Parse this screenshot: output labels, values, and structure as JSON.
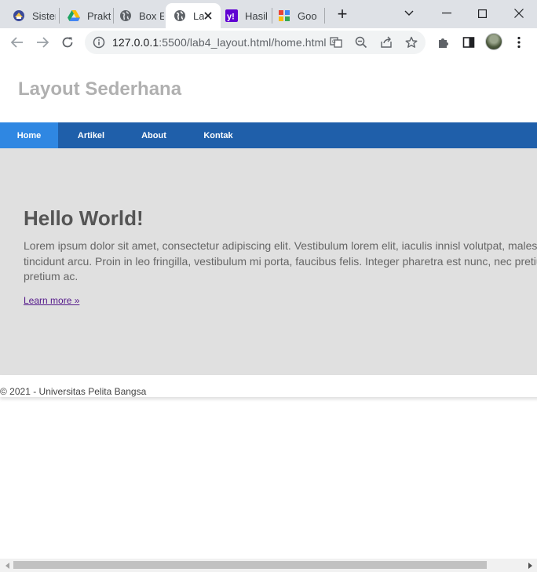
{
  "browser": {
    "tabs": [
      {
        "title": "Sister",
        "icon": "university-favicon-icon",
        "active": false
      },
      {
        "title": "Prakt",
        "icon": "google-drive-icon",
        "active": false
      },
      {
        "title": "Box E",
        "icon": "globe-icon",
        "active": false
      },
      {
        "title": "La",
        "icon": "globe-icon",
        "active": true
      },
      {
        "title": "Hasil",
        "icon": "yahoo-icon",
        "active": false
      },
      {
        "title": "Goo",
        "icon": "google-favicon-icon",
        "active": false
      }
    ],
    "new_tab_label": "+",
    "address": {
      "host": "127.0.0.1",
      "rest": ":5500/lab4_layout.html/home.html"
    }
  },
  "page": {
    "site_title": "Layout Sederhana",
    "nav": [
      {
        "label": "Home",
        "active": true
      },
      {
        "label": "Artikel",
        "active": false
      },
      {
        "label": "About",
        "active": false
      },
      {
        "label": "Kontak",
        "active": false
      }
    ],
    "hero": {
      "title": "Hello World!",
      "text": "Lorem ipsum dolor sit amet, consectetur adipiscing elit. Vestibulum lorem elit, iaculis innisl volutpat, malesuada tincidunt arcu. Proin in leo fringilla, vestibulum mi porta, faucibus felis. Integer pharetra est nunc, nec pretium nunc pretium ac.",
      "link": "Learn more »"
    },
    "footer": "© 2021 - Universitas Pelita Bangsa"
  },
  "colors": {
    "nav_background": "#1f5faa",
    "nav_active": "#2f87e2",
    "hero_background": "#e0e0e0",
    "title_color": "#b0b0b0"
  }
}
